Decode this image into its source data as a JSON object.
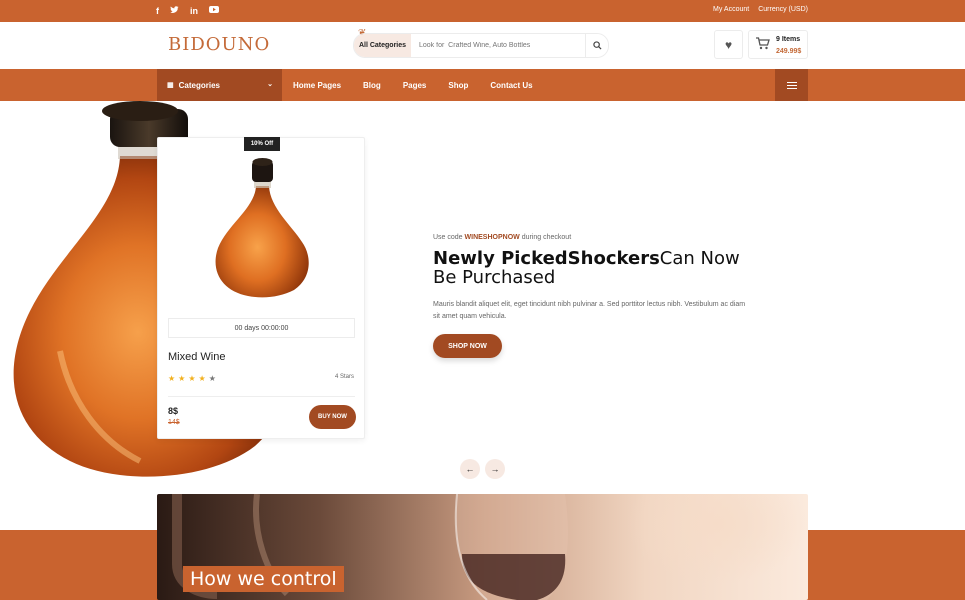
{
  "topbar": {
    "social_icons": [
      "facebook-icon",
      "twitter-icon",
      "linkedin-icon",
      "youtube-icon"
    ],
    "my_account": "My Account",
    "currency": "Currency (USD)"
  },
  "header": {
    "logo": "BIDOUNO",
    "search_category": "All Categories",
    "search_placeholder": "Look for  Crafted Wine, Auto Bottles",
    "cart_items": "9 Items",
    "cart_total": "249.99$"
  },
  "nav": {
    "categories_label": "Categories",
    "links": [
      "Home Pages",
      "Blog",
      "Pages",
      "Shop",
      "Contact Us"
    ]
  },
  "card": {
    "badge": "10% Off",
    "countdown": "00 days 00:00:00",
    "name": "Mixed Wine",
    "rating": 4,
    "rating_max": 5,
    "rating_label": "4 Stars",
    "price": "8$",
    "old_price": "14$",
    "buy_label": "BUY NOW"
  },
  "hero": {
    "promo_prefix": "Use code",
    "promo_code": "WINESHOPNOW",
    "promo_suffix": "during checkout",
    "headline_bold": "Newly PickedShockers",
    "headline_rest": "Can Now Be Purchased",
    "description": "Mauris blandit aliquet elit, eget tincidunt nibh pulvinar a. Sed porttitor lectus nibh. Vestibulum ac diam sit amet quam vehicula.",
    "cta": "SHOP NOW"
  },
  "banner": {
    "title": "How we control"
  },
  "colors": {
    "accent": "#c9632f",
    "accent_dark": "#a24a22",
    "badge_bg": "#222222",
    "star": "#f2b01e"
  }
}
